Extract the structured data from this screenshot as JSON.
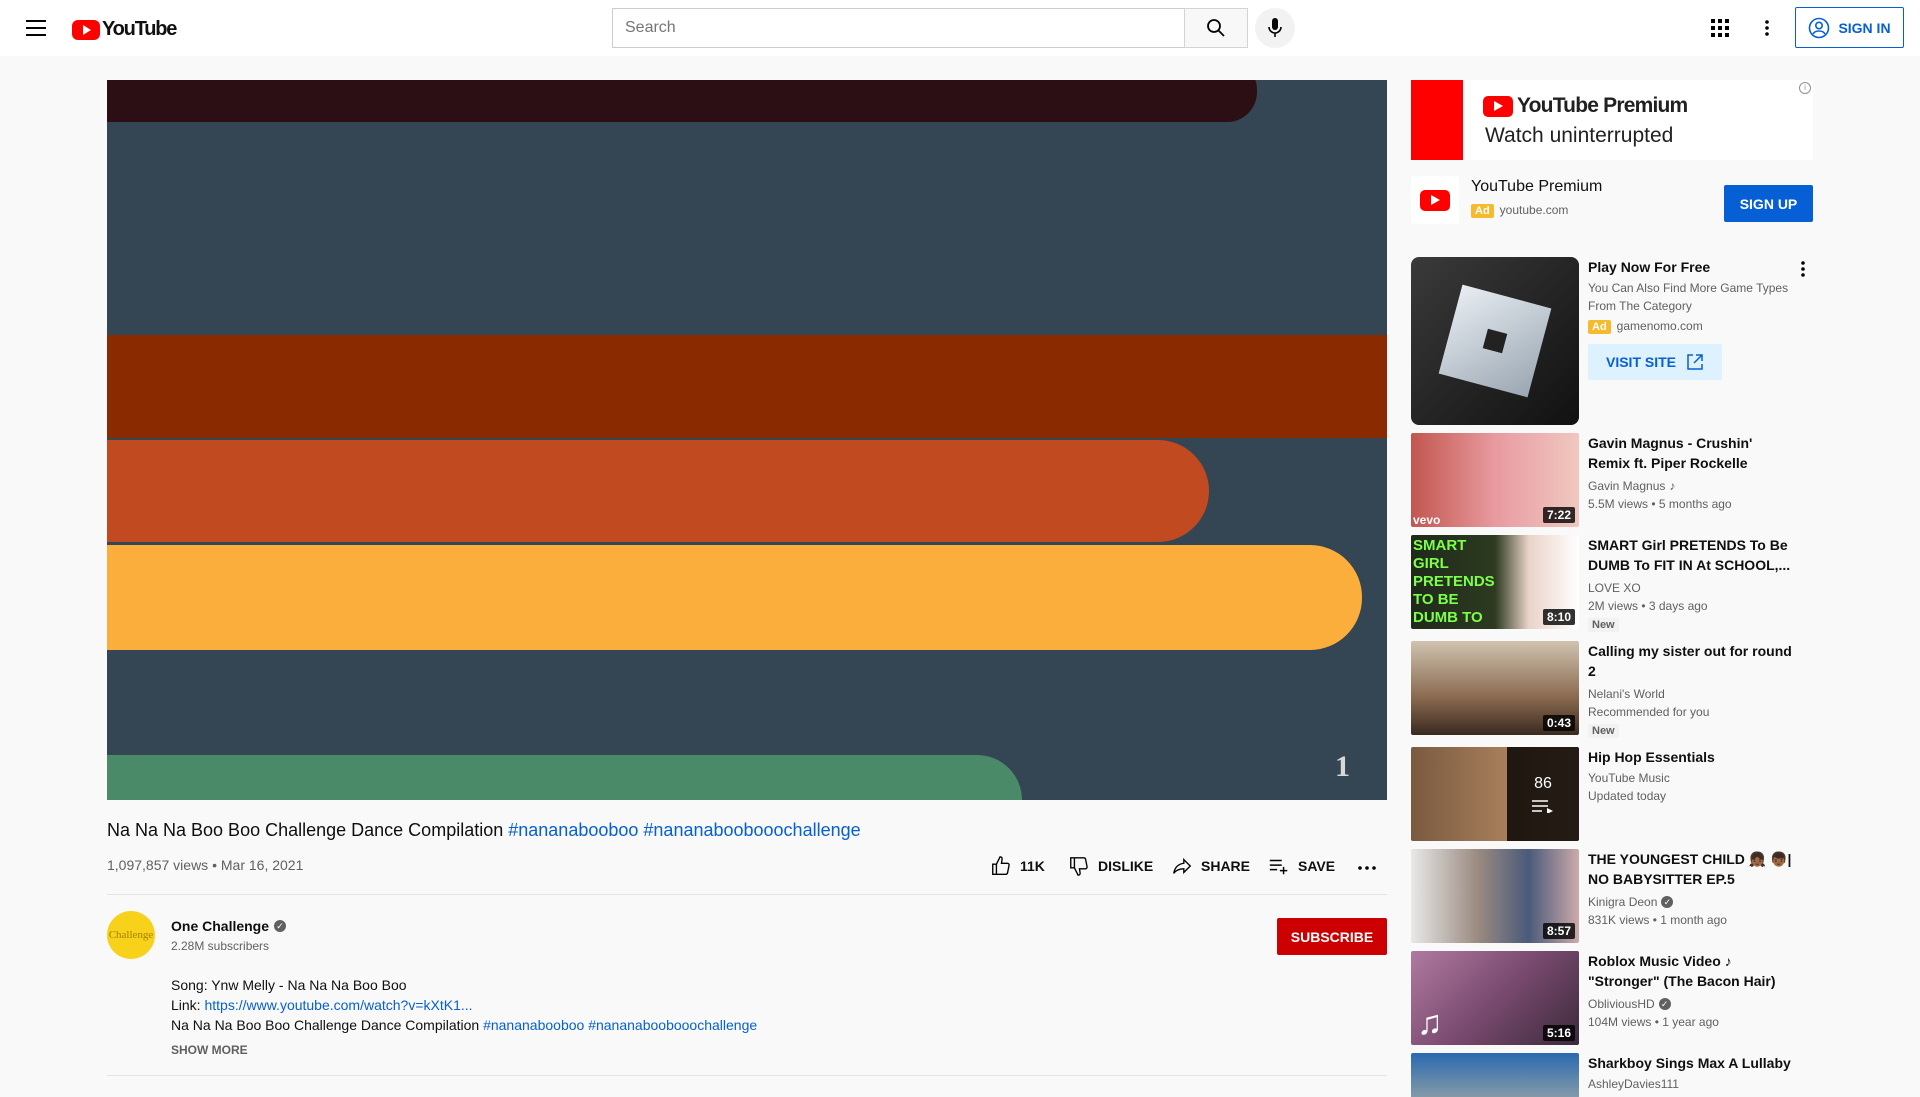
{
  "header": {
    "logo_text": "YouTube",
    "search_placeholder": "Search",
    "sign_in_label": "SIGN IN"
  },
  "video": {
    "title_text": "Na Na Na Boo Boo Challenge Dance Compilation",
    "title_tags": [
      "#nananabooboo",
      "#nananaboobooochallenge"
    ],
    "views": "1,097,857 views",
    "date": "Mar 16, 2021",
    "likes": "11K",
    "dislike_label": "DISLIKE",
    "share_label": "SHARE",
    "save_label": "SAVE",
    "bar_colors": [
      "#2b0f14",
      "#8a2a00",
      "#c24a20",
      "#fbae3b",
      "#4a8a68"
    ],
    "watermark": "1"
  },
  "channel": {
    "name": "One Challenge",
    "subscribers": "2.28M subscribers",
    "avatar_text": "Challenge",
    "subscribe_label": "SUBSCRIBE"
  },
  "description": {
    "line1": "Song: Ynw Melly - Na Na Na Boo Boo",
    "line2_prefix": "Link: ",
    "line2_link": "https://www.youtube.com/watch?v=kXtK1...",
    "line3_text": "Na Na Na Boo Boo Challenge Dance Compilation",
    "line3_tags": [
      "#nananabooboo",
      "#nananaboobooochallenge"
    ],
    "show_more": "SHOW MORE"
  },
  "ad_premium": {
    "banner_brand": "YouTube Premium",
    "banner_tagline": "Watch uninterrupted",
    "title": "YouTube Premium",
    "badge": "Ad",
    "domain": "youtube.com",
    "button": "SIGN UP"
  },
  "ad_game": {
    "title": "Play Now For Free",
    "desc": "You Can Also Find More Game Types From The Category",
    "badge": "Ad",
    "domain": "gamenomo.com",
    "button": "VISIT SITE"
  },
  "recommendations": [
    {
      "title": "Gavin Magnus - Crushin' Remix ft. Piper Rockelle (Official Mus...",
      "channel": "Gavin Magnus",
      "meta": "5.5M views • 5 months ago",
      "duration": "7:22",
      "badge": "",
      "thumb_label": "vevo"
    },
    {
      "title": "SMART Girl PRETENDS To Be DUMB To FIT IN At SCHOOL,...",
      "channel": "LOVE XO",
      "meta": "2M views • 3 days ago",
      "duration": "8:10",
      "badge": "New",
      "thumb_label": "SMART GIRL PRETENDS TO BE DUMB TO FIT IN AT SCHOOL"
    },
    {
      "title": "Calling my sister out for round 2",
      "channel": "Nelani's World",
      "meta": "Recommended for you",
      "duration": "0:43",
      "badge": "New",
      "thumb_label": ""
    },
    {
      "title": "Hip Hop Essentials",
      "channel": "YouTube Music",
      "meta": "Updated today",
      "duration": "",
      "badge": "",
      "thumb_label": "86"
    },
    {
      "title": "THE YOUNGEST CHILD 👧🏾 👦🏾| NO BABYSITTER EP.5",
      "channel": "Kinigra Deon",
      "meta": "831K views • 1 month ago",
      "duration": "8:57",
      "badge": "",
      "thumb_label": ""
    },
    {
      "title": "Roblox Music Video ♪ \"Stronger\" (The Bacon Hair)",
      "channel": "ObliviousHD",
      "meta": "104M views • 1 year ago",
      "duration": "5:16",
      "badge": "",
      "thumb_label": ""
    },
    {
      "title": "Sharkboy Sings Max A Lullaby",
      "channel": "AshleyDavies111",
      "meta": "",
      "duration": "",
      "badge": "",
      "thumb_label": ""
    }
  ]
}
